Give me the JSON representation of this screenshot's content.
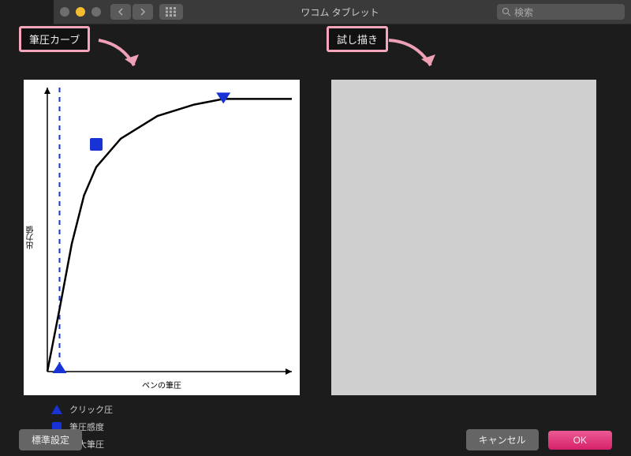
{
  "window": {
    "title": "ワコム タブレット",
    "search_placeholder": "検索"
  },
  "traffic": {
    "close": "#6e6e6e",
    "min": "#f5bd2f",
    "max": "#6e6e6e"
  },
  "badges": {
    "curve": "筆圧カーブ",
    "try": "試し描き"
  },
  "chart_data": {
    "type": "line",
    "title": "",
    "xlabel": "ペンの筆圧",
    "ylabel": "出力値",
    "xlim": [
      0,
      100
    ],
    "ylim": [
      0,
      100
    ],
    "curve": [
      {
        "x": 0,
        "y": 0
      },
      {
        "x": 5,
        "y": 22
      },
      {
        "x": 10,
        "y": 45
      },
      {
        "x": 15,
        "y": 62
      },
      {
        "x": 20,
        "y": 72
      },
      {
        "x": 30,
        "y": 82
      },
      {
        "x": 45,
        "y": 90
      },
      {
        "x": 60,
        "y": 94
      },
      {
        "x": 72,
        "y": 96
      },
      {
        "x": 100,
        "y": 96
      }
    ],
    "handles": {
      "click_threshold": {
        "x": 5,
        "y": 0
      },
      "sensitivity": {
        "x": 20,
        "y": 80
      },
      "max_pressure": {
        "x": 72,
        "y": 96
      }
    },
    "threshold_line_x": 5
  },
  "legend": {
    "click": "クリック圧",
    "sensitivity": "筆圧感度",
    "max": "最大筆圧"
  },
  "colors": {
    "handle": "#1733d5",
    "curve": "#000000",
    "dashed": "#1733d5",
    "badge_border": "#f6a6bb",
    "arrow": "#eea0b7"
  },
  "buttons": {
    "defaults": "標準設定",
    "cancel": "キャンセル",
    "ok": "OK"
  }
}
